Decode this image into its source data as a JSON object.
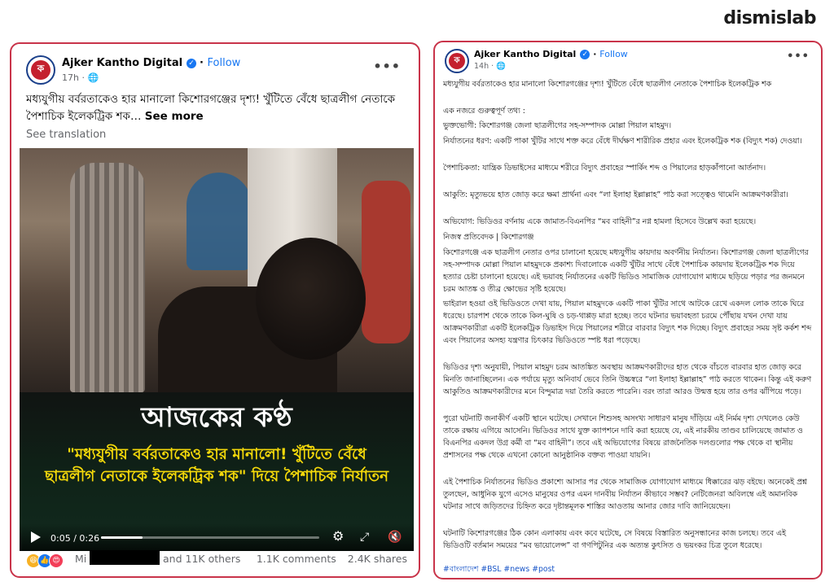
{
  "brand": "dismislab",
  "left_post": {
    "page_name": "Ajker Kantho Digital",
    "follow_label": "Follow",
    "time": "17h · ",
    "more_label": "•••",
    "text": "মধ্যযুগীয় বর্বরতাকেও হার মানালো কিশোরগঞ্জের দৃশ্য! খুঁটিতে বেঁধে ছাত্রলীগ নেতাকে পৈশাচিক ইলেকট্রিক শক…",
    "see_more": "See more",
    "see_translation": "See translation",
    "video": {
      "overlay_title": "আজকের কণ্ঠ",
      "overlay_quote": "\"মধ্যযুগীয় বর্বরতাকেও হার মানালো! খুঁটিতে বেঁধে ছাত্রলীগ নেতাকে ইলেকট্রিক শক\" দিয়ে পৈশাচিক নির্যাতন",
      "time": "0:05 / 0:26",
      "progress": 0.19
    },
    "reactor_name": "Mi",
    "reactions_others": "and 11K others",
    "comments": "1.1K comments",
    "shares": "2.4K shares"
  },
  "right_post": {
    "page_name": "Ajker Kantho Digital",
    "follow_label": "Follow",
    "time": "14h · ",
    "more_label": "•••",
    "paragraphs": [
      "মধ্যযুগীয় বর্বরতাকেও হার মানালো কিশোরগঞ্জের দৃশ্য! খুঁটিতে বেঁধে ছাত্রলীগ নেতাকে পৈশাচিক ইলেকট্রিক শক",
      "এক নজরে গুরুত্বপূর্ণ তথ্য :",
      "ভুক্তভোগী: কিশোরগঞ্জ জেলা ছাত্রলীগের সহ-সম্পাদক মোল্লা পিয়াল মাহমুদ।",
      "নির্যাতনের ধরণ: একটি পাকা খুঁটির সাথে শক্ত করে বেঁধে দীর্ঘক্ষণ শারীরিক প্রহার এবং ইলেকট্রিক শক (বিদ্যুৎ শক) দেওয়া।",
      "পৈশাচিকতা: যান্ত্রিক ডিভাইসের মাধ্যমে শরীরে বিদ্যুৎ প্রবাহের স্পার্কিং শব্দ ও পিয়ালের হাড়কাঁপানো আর্তনাদ।",
      "আকুতি: মৃত্যুভয়ে হাত জোড় করে ক্ষমা প্রার্থনা এবং “লা ইলাহা ইল্লাল্লাহ” পাঠ করা সত্ত্বেও থামেনি আক্রমণকারীরা।",
      "অভিযোগ: ভিডিওর বর্ণনায় একে জামাত-বিএনপির “মব বাহিনী”র নগ্ন হামলা হিসেবে উল্লেখ করা হয়েছে।",
      "নিজস্ব প্রতিবেদক | কিশোরগঞ্জ",
      "কিশোরগঞ্জে এক ছাত্রলীগ নেতার ওপর চালানো হয়েছে মধ্যযুগীয় কায়দায় অবর্ণনীয় নির্যাতন। কিশোরগঞ্জ জেলা ছাত্রলীগের সহ-সম্পাদক মোল্লা পিয়াল মাহমুদকে প্রকাশ্য দিবালোকে একটি খুঁটির সাথে বেঁধে পৈশাচিক কায়দায় ইলেকট্রিক শক দিয়ে হত্যার চেষ্টা চালানো হয়েছে। এই ভয়াবহ নির্যাতনের একটি ভিডিও সামাজিক যোগাযোগ মাধ্যমে ছড়িয়ে পড়ার পর জনমনে চরম আতঙ্ক ও তীব্র ক্ষোভের সৃষ্টি হয়েছে।",
      "ভাইরাল হওয়া ওই ভিডিওতে দেখা যায়, পিয়াল মাহমুদকে একটি পাকা খুঁটির সাথে আটকে রেখে একদল লোক তাকে ঘিরে ধরেছে। চারপাশ থেকে তাকে কিল-ঘুষি ও চড়-থাপ্পড় মারা হচ্ছে। তবে ঘটনার ভয়াবহতা চরমে পৌঁছায় যখন দেখা যায় আক্রমণকারীরা একটি ইলেকট্রিক ডিভাইস দিয়ে পিয়ালের শরীরে বারবার বিদ্যুৎ শক দিচ্ছে। বিদ্যুৎ প্রবাহের সময় সৃষ্ট কর্কশ শব্দ এবং পিয়ালের অসহ্য যন্ত্রণার চিৎকার ভিডিওতে স্পষ্ট ধরা পড়েছে।",
      "ভিডিওর দৃশ্য অনুযায়ী, পিয়াল মাহমুদ চরম আতঙ্কিত অবস্থায় আক্রমণকারীদের হাত থেকে বাঁচতে বারবার হাত জোড় করে মিনতি জানাচ্ছিলেন। এক পর্যায়ে মৃত্যু অনিবার্য ভেবে তিনি উচ্চস্বরে “লা ইলাহা ইল্লাল্লাহ” পাঠ করতে থাকেন। কিন্তু এই করুণ আকুতিও আক্রমণকারীদের মনে বিন্দুমাত্র দয়া তৈরি করতে পারেনি। বরং তারা আরও উন্মত্ত হয়ে তার ওপর ঝাঁপিয়ে পড়ে।",
      "পুরো ঘটনাটি জনাকীর্ণ একটি স্থানে ঘটেছে। সেখানে শিশুসহ অসংখ্য সাধারণ মানুষ দাঁড়িয়ে এই নির্মম দৃশ্য দেখলেও কেউ তাকে রক্ষায় এগিয়ে আসেনি। ভিডিওর সাথে যুক্ত ক্যাপশনে দাবি করা হয়েছে যে, এই নারকীয় তাণ্ডব চালিয়েছে জামাত ও বিএনপির একদল উগ্র কর্মী বা “মব বাহিনী”। তবে এই অভিযোগের বিষয়ে রাজনৈতিক দলগুলোর পক্ষ থেকে বা স্থানীয় প্রশাসনের পক্ষ থেকে এখনো কোনো আনুষ্ঠানিক বক্তব্য পাওয়া যায়নি।",
      "এই পৈশাচিক নির্যাতনের ভিডিও প্রকাশ্যে আসার পর থেকে সামাজিক যোগাযোগ মাধ্যমে ধিক্কারের ঝড় বইছে। অনেকেই প্রশ্ন তুলছেন, আধুনিক যুগে এসেও মানুষের ওপর এমন দানবীয় নির্যাতন কীভাবে সম্ভব? নেটিজেনরা অবিলম্বে এই অমানবিক ঘটনার সাথে জড়িতদের চিহ্নিত করে দৃষ্টান্তমূলক শাস্তির আওতায় আনার জোর দাবি জানিয়েছেন।",
      "ঘটনাটি কিশোরগঞ্জের ঠিক কোন এলাকায় এবং কবে ঘটেছে, সে বিষয়ে বিস্তারিত অনুসন্ধানের কাজ চলছে। তবে এই ভিডিওটি বর্তমান সময়ের “মব ভায়োলেন্স” বা গণপিটুনির এক অত্যন্ত কুৎসিত ও ভয়ংকর চিত্র তুলে ধরেছে।"
    ],
    "hashtags": "#বাংলাদেশ #BSL #news #post"
  }
}
